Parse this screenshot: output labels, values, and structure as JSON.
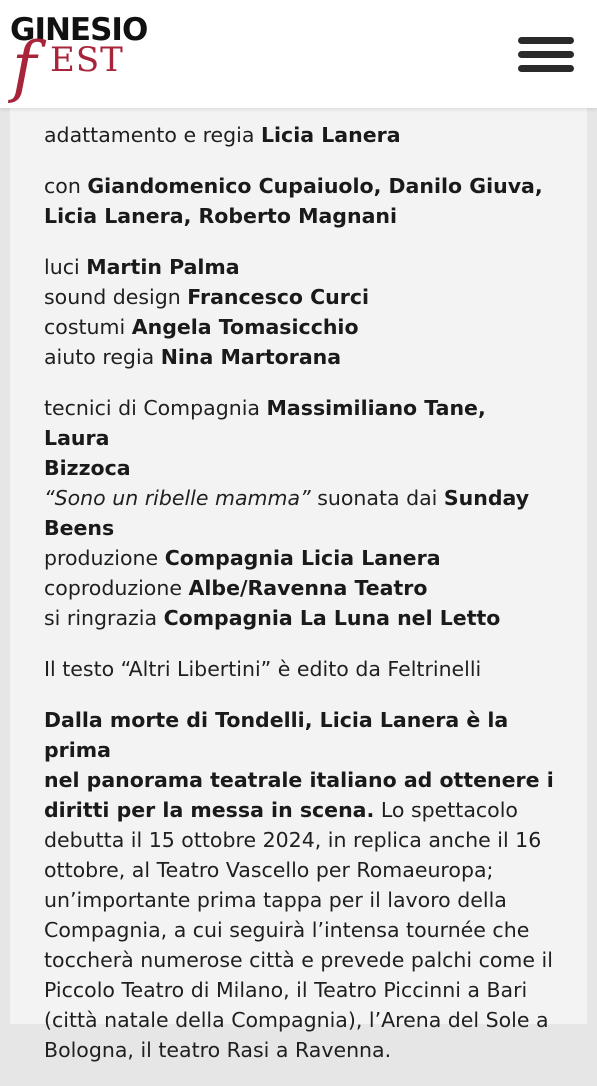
{
  "header": {
    "logo_line1": "GINESIO",
    "logo_f": "f",
    "logo_est": "EST",
    "menu_icon": "hamburger-menu-icon"
  },
  "credits": {
    "adattamento_label": "adattamento e regia",
    "adattamento_name": "Licia Lanera",
    "con_label": "con",
    "con_names_1": "Giandomenico Cupaiuolo, Danilo Giuva,",
    "con_names_2": "Licia Lanera, Roberto Magnani",
    "luci_label": "luci",
    "luci_name": "Martin Palma",
    "sound_label": "sound design",
    "sound_name": "Francesco Curci",
    "costumi_label": "costumi",
    "costumi_name": "Angela Tomasicchio",
    "aiuto_label": "aiuto regia",
    "aiuto_name": "Nina Martorana",
    "tecnici_label": "tecnici di Compagnia",
    "tecnici_names_1": "Massimiliano Tane, Laura",
    "tecnici_names_2": "Bizzoca",
    "song_title": "“Sono un ribelle mamma”",
    "song_label": "suonata dai",
    "song_band_1": "Sunday",
    "song_band_2": "Beens",
    "produzione_label": "produzione",
    "produzione_name": "Compagnia Licia Lanera",
    "coproduzione_label": "coproduzione",
    "coproduzione_name": "Albe/Ravenna Teatro",
    "ringrazia_label": "si ringrazia",
    "ringrazia_name": "Compagnia La Luna nel Letto"
  },
  "publisher_note": "Il testo “Altri Libertini” è edito da Feltrinelli",
  "paragraph": {
    "bold_1": "Dalla morte di Tondelli, Licia Lanera è la prima",
    "bold_2": "nel panorama teatrale italiano ad ottenere i",
    "bold_3": "diritti per la messa in scena.",
    "text_1": "Lo spettacolo",
    "text_2": "debutta il 15 ottobre 2024, in replica anche il 16",
    "text_3": "ottobre, al Teatro Vascello per Romaeuropa;",
    "text_4": "un’importante prima tappa per il lavoro della",
    "text_5": "Compagnia, a cui seguirà l’intensa tournée che",
    "text_6": "toccherà numerose città e prevede palchi come il",
    "text_7": "Piccolo Teatro di Milano, il Teatro Piccinni a Bari",
    "text_8": "(città natale della Compagnia), l’Arena del Sole a",
    "text_9": "Bologna, il teatro Rasi a Ravenna."
  }
}
